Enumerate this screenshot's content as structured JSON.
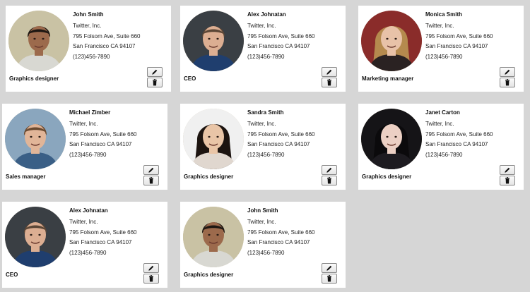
{
  "contacts": [
    {
      "name": "John Smith",
      "company": "Twitter, Inc.",
      "address": "795 Folsom Ave, Suite 660",
      "city": "San Francisco CA 94107",
      "phone": "(123)456-7890",
      "role": "Graphics designer",
      "photo": "man-dark-hair-photo",
      "colors": {
        "bg": "#c9c2a4",
        "skin": "#9c6a4c",
        "hair": "#1e1712",
        "shirt": "#d8d8d2"
      }
    },
    {
      "name": "Alex Johnatan",
      "company": "Twitter, Inc.",
      "address": "795 Folsom Ave, Suite 660",
      "city": "San Francisco CA 94107",
      "phone": "(123)456-7890",
      "role": "CEO",
      "photo": "man-short-hair-photo",
      "colors": {
        "bg": "#3a3f44",
        "skin": "#dcae92",
        "hair": "#5b4636",
        "shirt": "#1f3e6e"
      }
    },
    {
      "name": "Monica Smith",
      "company": "Twitter, Inc.",
      "address": "795 Folsom Ave, Suite 660",
      "city": "San Francisco CA 94107",
      "phone": "(123)456-7890",
      "role": "Marketing manager",
      "photo": "woman-curly-hair-photo",
      "colors": {
        "bg": "#8a2c2a",
        "skin": "#e8c2a8",
        "hair": "#b58a4e",
        "shirt": "#2a2222"
      }
    },
    {
      "name": "Michael Zimber",
      "company": "Twitter, Inc.",
      "address": "795 Folsom Ave, Suite 660",
      "city": "San Francisco CA 94107",
      "phone": "(123)456-7890",
      "role": "Sales manager",
      "photo": "man-smiling-photo",
      "colors": {
        "bg": "#8aa6be",
        "skin": "#e1b598",
        "hair": "#6a4a30",
        "shirt": "#3a5f86"
      }
    },
    {
      "name": "Sandra Smith",
      "company": "Twitter, Inc.",
      "address": "795 Folsom Ave, Suite 660",
      "city": "San Francisco CA 94107",
      "phone": "(123)456-7890",
      "role": "Graphics designer",
      "photo": "woman-long-hair-photo",
      "colors": {
        "bg": "#f0f0f0",
        "skin": "#e9c5a7",
        "hair": "#1c1410",
        "shirt": "#e0d7cf"
      }
    },
    {
      "name": "Janet Carton",
      "company": "Twitter, Inc.",
      "address": "795 Folsom Ave, Suite 660",
      "city": "San Francisco CA 94107",
      "phone": "(123)456-7890",
      "role": "Graphics designer",
      "photo": "woman-dark-hair-photo",
      "colors": {
        "bg": "#151417",
        "skin": "#ecd0c4",
        "hair": "#0b0a0c",
        "shirt": "#1d1b20"
      }
    },
    {
      "name": "Alex Johnatan",
      "company": "Twitter, Inc.",
      "address": "795 Folsom Ave, Suite 660",
      "city": "San Francisco CA 94107",
      "phone": "(123)456-7890",
      "role": "CEO",
      "photo": "man-short-hair-photo",
      "colors": {
        "bg": "#3a3f44",
        "skin": "#dcae92",
        "hair": "#5b4636",
        "shirt": "#1f3e6e"
      }
    },
    {
      "name": "John Smith",
      "company": "Twitter, Inc.",
      "address": "795 Folsom Ave, Suite 660",
      "city": "San Francisco CA 94107",
      "phone": "(123)456-7890",
      "role": "Graphics designer",
      "photo": "man-dark-hair-photo",
      "colors": {
        "bg": "#c9c2a4",
        "skin": "#9c6a4c",
        "hair": "#1e1712",
        "shirt": "#d8d8d2"
      }
    }
  ],
  "actions": {
    "edit_icon": "pencil-icon",
    "delete_icon": "trash-icon"
  }
}
